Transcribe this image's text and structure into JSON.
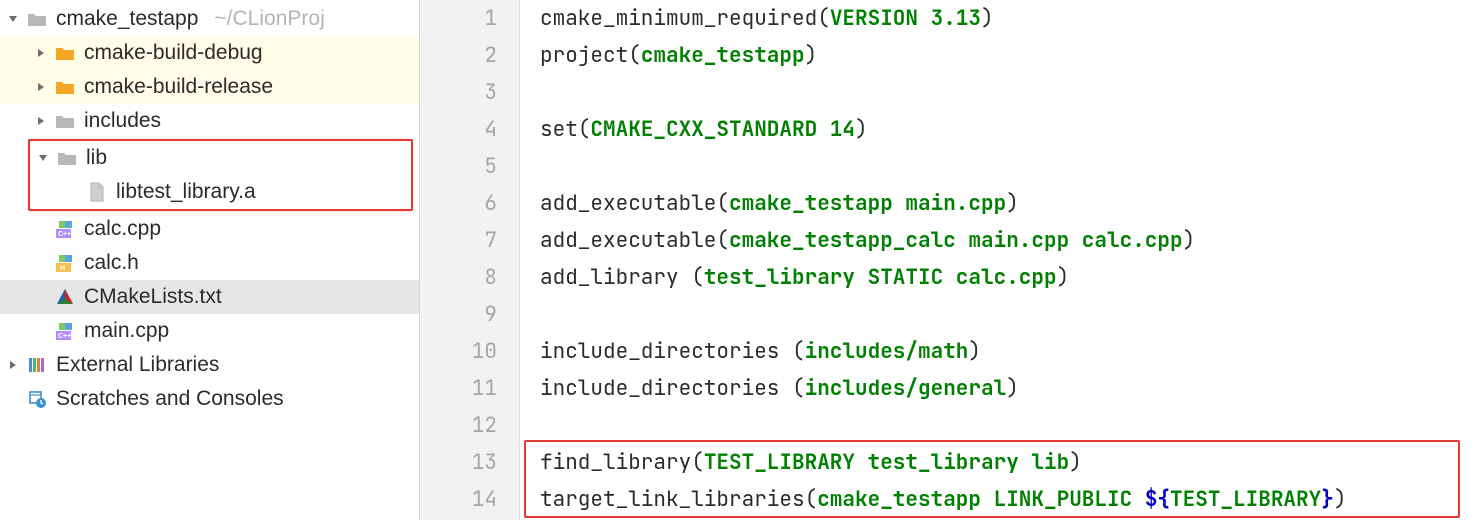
{
  "tree": {
    "root": {
      "label": "cmake_testapp",
      "path_hint": "~/CLionProj"
    },
    "build_debug": {
      "label": "cmake-build-debug"
    },
    "build_release": {
      "label": "cmake-build-release"
    },
    "includes": {
      "label": "includes"
    },
    "lib": {
      "label": "lib"
    },
    "libfile": {
      "label": "libtest_library.a"
    },
    "calc_cpp": {
      "label": "calc.cpp"
    },
    "calc_h": {
      "label": "calc.h"
    },
    "cmakelists": {
      "label": "CMakeLists.txt"
    },
    "main_cpp": {
      "label": "main.cpp"
    },
    "external_libs": {
      "label": "External Libraries"
    },
    "scratches": {
      "label": "Scratches and Consoles"
    }
  },
  "editor": {
    "code": [
      {
        "plain1": "cmake_minimum_required(",
        "green": "VERSION 3.13",
        "plain2": ")"
      },
      {
        "plain1": "project(",
        "green": "cmake_testapp",
        "plain2": ")"
      },
      {
        "plain1": ""
      },
      {
        "plain1": "set(",
        "green": "CMAKE_CXX_STANDARD 14",
        "plain2": ")"
      },
      {
        "plain1": ""
      },
      {
        "plain1": "add_executable(",
        "green": "cmake_testapp main.cpp",
        "plain2": ")"
      },
      {
        "plain1": "add_executable(",
        "green": "cmake_testapp_calc main.cpp calc.cpp",
        "plain2": ")"
      },
      {
        "plain1": "add_library (",
        "green": "test_library STATIC calc.cpp",
        "plain2": ")"
      },
      {
        "plain1": ""
      },
      {
        "plain1": "include_directories (",
        "green": "includes/math",
        "plain2": ")"
      },
      {
        "plain1": "include_directories (",
        "green": "includes/general",
        "plain2": ")"
      },
      {
        "plain1": ""
      },
      {
        "plain1": "find_library(",
        "green": "TEST_LIBRARY test_library lib",
        "plain2": ")"
      },
      {
        "plain1": "target_link_libraries(",
        "green": "cmake_testapp LINK_PUBLIC ",
        "blue": "${",
        "green2": "TEST_LIBRARY",
        "blue2": "}",
        "plain2": ")"
      }
    ],
    "line_numbers": [
      "1",
      "2",
      "3",
      "4",
      "5",
      "6",
      "7",
      "8",
      "9",
      "10",
      "11",
      "12",
      "13",
      "14"
    ]
  }
}
